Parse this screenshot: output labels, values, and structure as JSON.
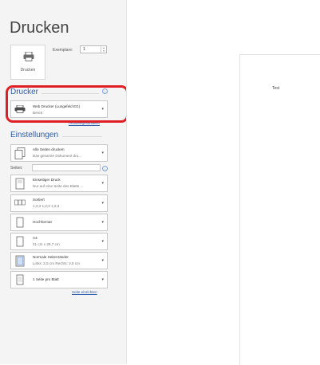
{
  "title": "Drucken",
  "print_button": {
    "label": "Drucken",
    "icon": "printer-icon"
  },
  "copies": {
    "label": "Exemplare:",
    "value": "1"
  },
  "printer_section": {
    "heading": "Drucker",
    "printer_name": "Web Drucker (Lungefeld EG)",
    "status": "Bereit",
    "properties_link": "Druckereigenschaften"
  },
  "settings_section": {
    "heading": "Einstellungen",
    "items": [
      {
        "main": "Alle Seiten drucken",
        "sub": "Das gesamte Dokument dru..."
      },
      {
        "main": "Einseitiger Druck",
        "sub": "Nur auf eine Seite des Blatts ..."
      },
      {
        "main": "Sortiert",
        "sub": "1;2;3    1;2;3    1;2;3"
      },
      {
        "main": "Hochformat",
        "sub": ""
      },
      {
        "main": "A4",
        "sub": "21 cm x 29,7 cm"
      },
      {
        "main": "Normale Seitenränder",
        "sub": "Links: 2,5 cm    Rechts: 2,5 cm"
      },
      {
        "main": "1 Seite pro Blatt",
        "sub": ""
      }
    ],
    "pages_label": "Seiten:",
    "page_setup_link": "Seite einrichten"
  },
  "preview": {
    "page_text": "Test"
  },
  "colors": {
    "accent": "#2f5da8",
    "highlight": "#e01f25",
    "panel": "#f4f4f4"
  }
}
